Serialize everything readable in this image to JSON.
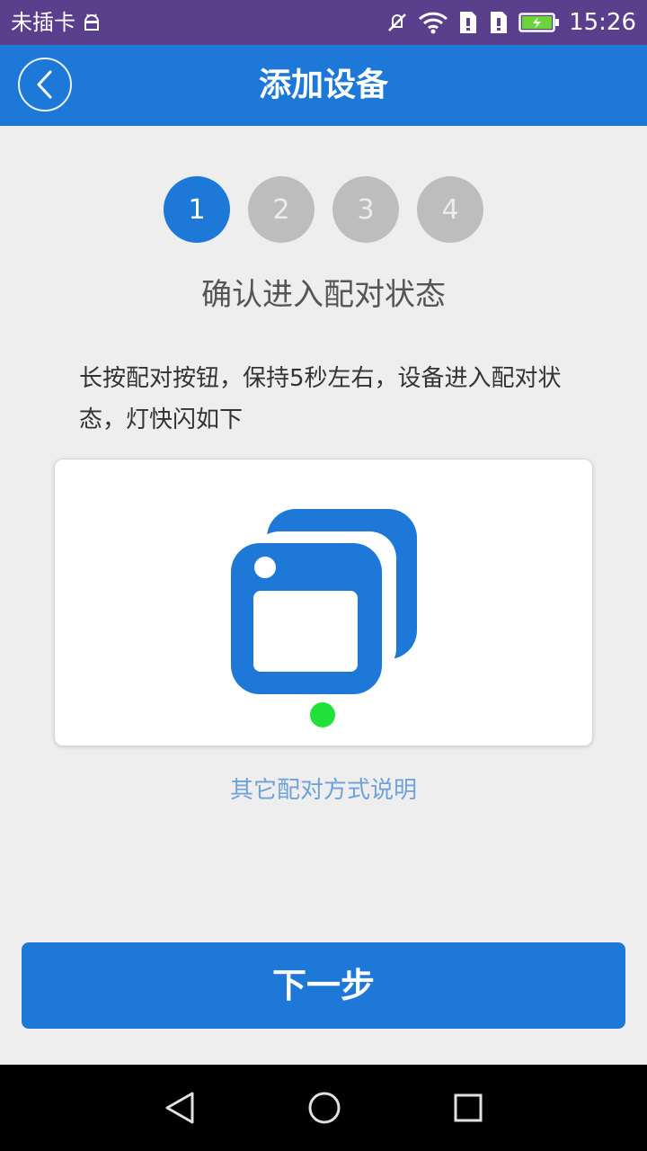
{
  "status_bar": {
    "carrier": "未插卡",
    "time": "15:26",
    "icons": [
      "android-icon",
      "mute-icon",
      "wifi-icon",
      "sim1-alert-icon",
      "sim2-alert-icon",
      "battery-charging-icon"
    ]
  },
  "header": {
    "title": "添加设备",
    "back_icon": "back-icon"
  },
  "steps": [
    "1",
    "2",
    "3",
    "4"
  ],
  "active_step": 1,
  "main": {
    "section_title": "确认进入配对状态",
    "description": "长按配对按钮，保持5秒左右，设备进入配对状态，灯快闪如下",
    "illustration_icon": "device-pairing-icon",
    "indicator_color": "#22e03a",
    "other_methods_link": "其它配对方式说明"
  },
  "footer": {
    "next_label": "下一步"
  },
  "nav_bar": {
    "back": "nav-back-icon",
    "home": "nav-home-icon",
    "recents": "nav-recents-icon"
  },
  "colors": {
    "status_bar": "#5a3f8c",
    "primary": "#1e78d7",
    "step_inactive": "#bdbdbd",
    "background": "#eeeeee"
  }
}
